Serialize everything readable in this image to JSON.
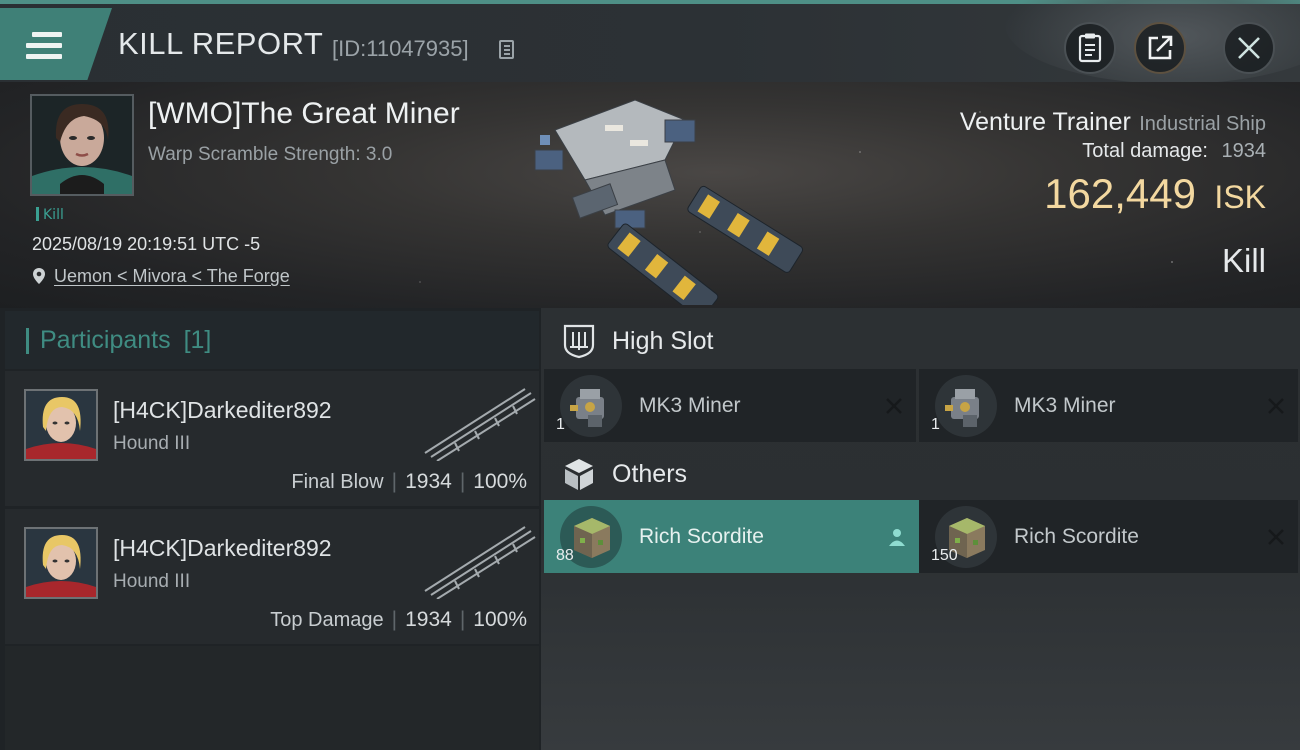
{
  "header": {
    "title": "KILL REPORT",
    "report_id": "[ID:11047935]"
  },
  "victim": {
    "pilot_name": "[WMO]The Great Miner",
    "warp_scramble": "Warp Scramble Strength: 3.0",
    "kill_tag": "Kill",
    "datetime": "2025/08/19 20:19:51 UTC -5",
    "location": "Uemon < Mivora < The Forge",
    "ship_name": "Venture Trainer",
    "ship_class": "Industrial Ship",
    "total_damage_label": "Total damage:",
    "total_damage": "1934",
    "isk_value": "162,449",
    "isk_unit": "ISK",
    "result": "Kill"
  },
  "participants": {
    "label": "Participants",
    "count": "[1]",
    "rows": [
      {
        "name": "[H4CK]Darkediter892",
        "ship": "Hound III",
        "role": "Final Blow",
        "damage": "1934",
        "percent": "100%"
      },
      {
        "name": "[H4CK]Darkediter892",
        "ship": "Hound III",
        "role": "Top Damage",
        "damage": "1934",
        "percent": "100%"
      }
    ]
  },
  "sections": {
    "high_slot": "High Slot",
    "others": "Others"
  },
  "items": [
    {
      "name": "MK3 Miner",
      "qty": "1",
      "status": "destroyed"
    },
    {
      "name": "MK3 Miner",
      "qty": "1",
      "status": "destroyed"
    },
    {
      "name": "Rich Scordite",
      "qty": "88",
      "status": "dropped"
    },
    {
      "name": "Rich Scordite",
      "qty": "150",
      "status": "destroyed"
    }
  ],
  "colors": {
    "accent": "#3f8c82",
    "highlight_row": "#3c8279",
    "isk": "#f3d8a0"
  }
}
